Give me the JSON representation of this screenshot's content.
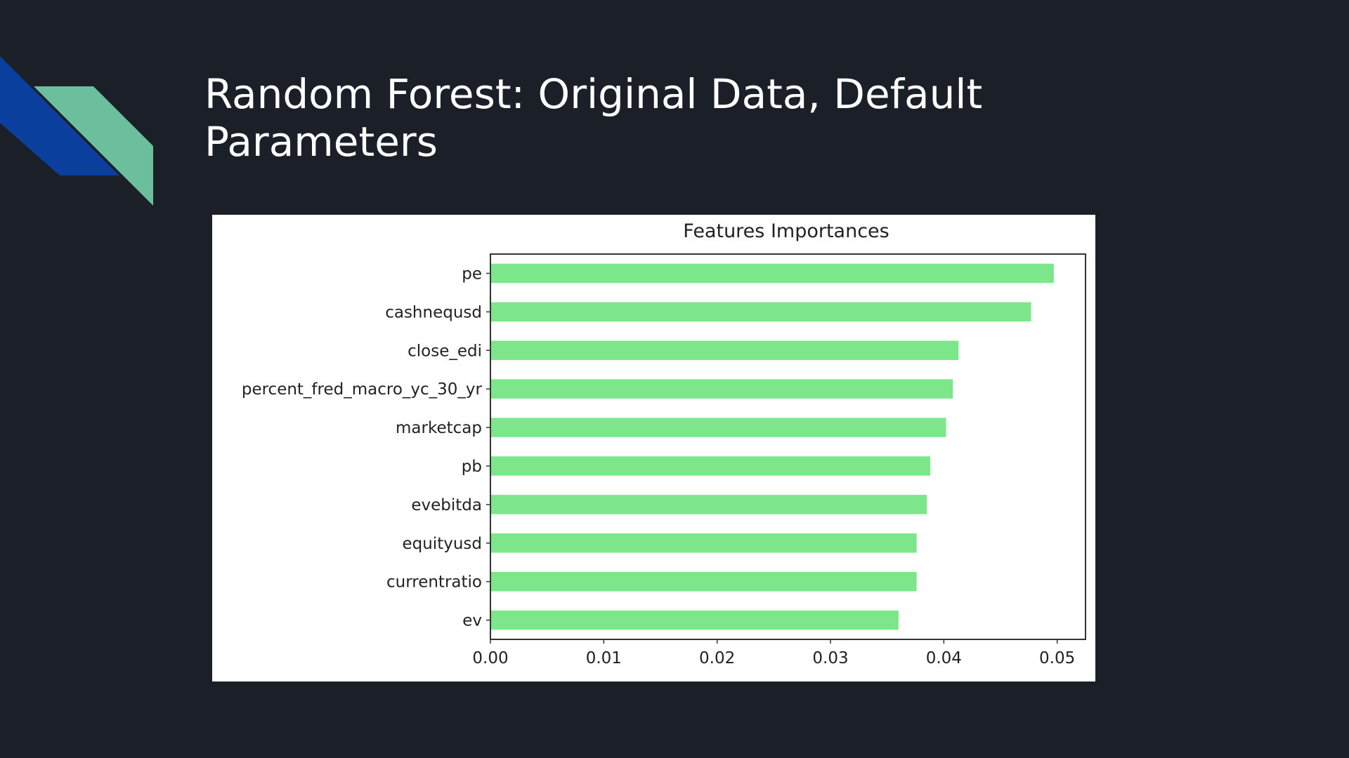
{
  "slide": {
    "title": "Random Forest: Original Data, Default Parameters",
    "colors": {
      "background": "#1b1f27",
      "accent_blue": "#0a3f9e",
      "accent_green": "#6bbf9c"
    }
  },
  "chart_data": {
    "type": "bar",
    "orientation": "horizontal",
    "title": "Features Importances",
    "xlabel": "",
    "ylabel": "",
    "categories": [
      "pe",
      "cashnequsd",
      "close_edi",
      "percent_fred_macro_yc_30_yr",
      "marketcap",
      "pb",
      "evebitda",
      "equityusd",
      "currentratio",
      "ev"
    ],
    "values": [
      0.0497,
      0.0477,
      0.0413,
      0.0408,
      0.0402,
      0.0388,
      0.0385,
      0.0376,
      0.0376,
      0.036
    ],
    "xlim": [
      0,
      0.0525
    ],
    "xticks": [
      "0.00",
      "0.01",
      "0.02",
      "0.03",
      "0.04",
      "0.05"
    ],
    "bar_color": "#7de68a",
    "grid": false,
    "legend": "none"
  }
}
